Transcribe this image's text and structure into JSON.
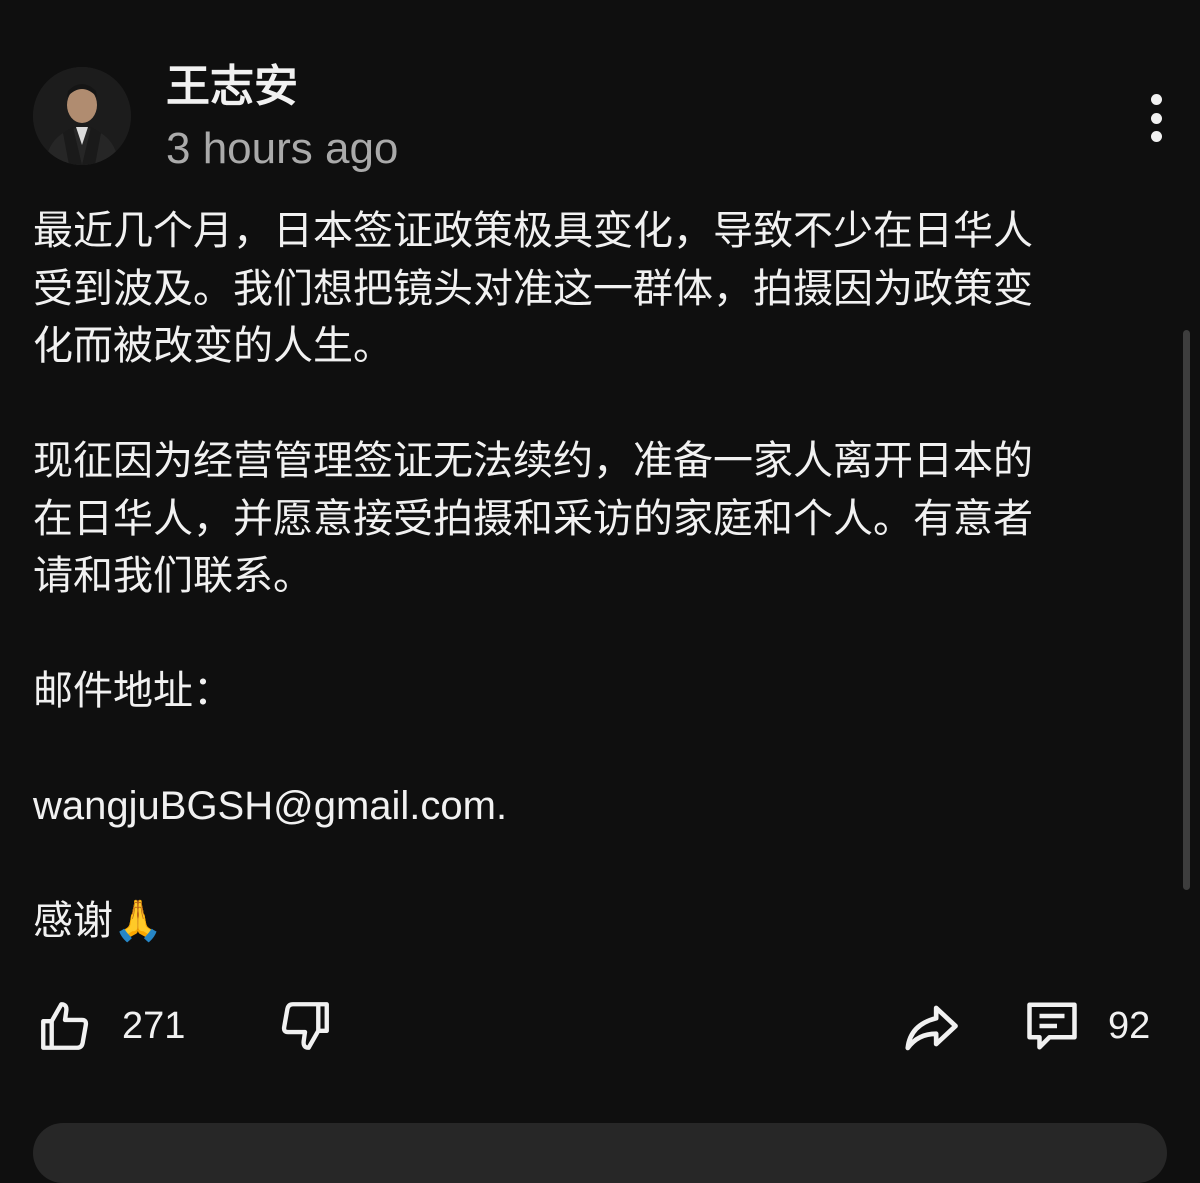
{
  "post": {
    "author": "王志安",
    "timestamp": "3 hours ago",
    "avatar_icon": "user-avatar",
    "more_icon": "more-vert-icon",
    "paragraphs": {
      "p1_l1": "最近几个月，日本签证政策极具变化，导致不少在日华人",
      "p1_l2": "受到波及。我们想把镜头对准这一群体，拍摄因为政策变",
      "p1_l3": "化而被改变的人生。",
      "p2_l1": "现征因为经营管理签证无法续约，准备一家人离开日本的",
      "p2_l2": "在日华人，并愿意接受拍摄和采访的家庭和个人。有意者",
      "p2_l3": "请和我们联系。",
      "p3": "邮件地址：",
      "email": "wangjuBGSH@gmail.com.",
      "thanks": "感谢",
      "thanks_emoji": "🙏"
    }
  },
  "actions": {
    "like_count": "271",
    "comment_count": "92",
    "like_icon": "thumbs-up-icon",
    "dislike_icon": "thumbs-down-icon",
    "share_icon": "share-icon",
    "comment_icon": "comment-icon"
  },
  "colors": {
    "background": "#0f0f0f",
    "text": "#f1f1f1",
    "muted": "#aaaaaa"
  }
}
